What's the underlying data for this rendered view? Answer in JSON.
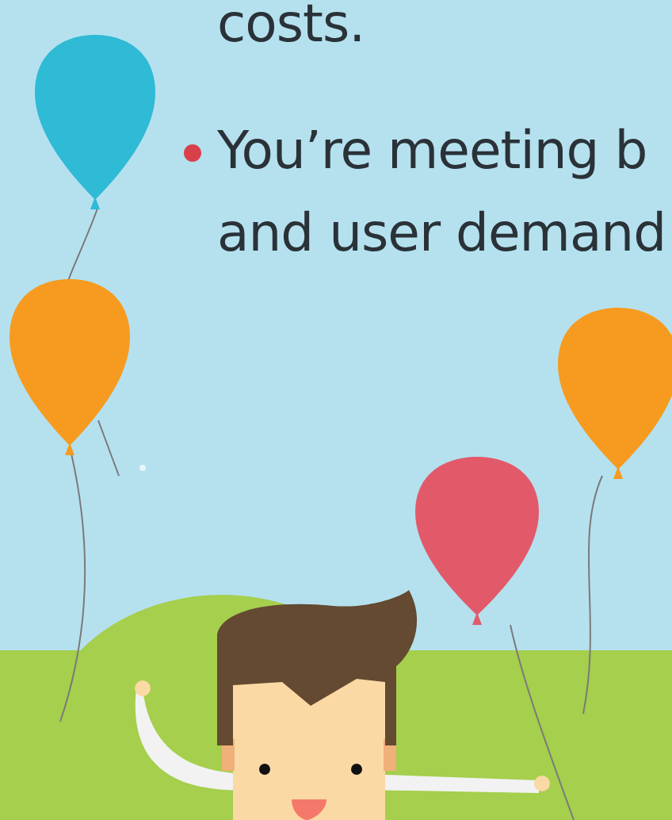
{
  "text_lines": [
    {
      "kind": "continuation",
      "text": "costs."
    },
    {
      "kind": "gap"
    },
    {
      "kind": "bullet",
      "text": "You’re meeting b"
    },
    {
      "kind": "continuation",
      "text": "and user demand"
    }
  ]
}
